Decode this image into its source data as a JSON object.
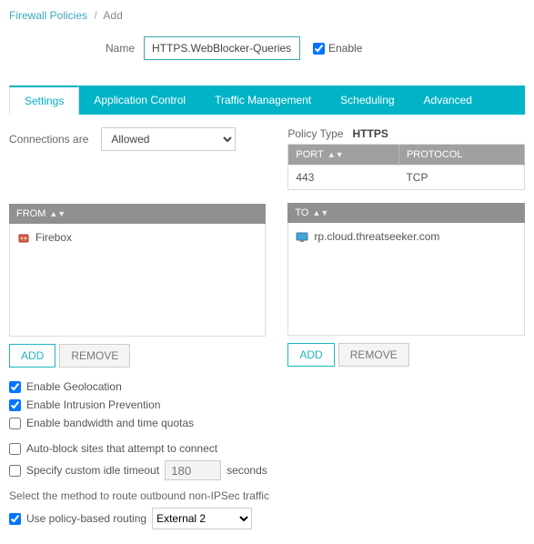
{
  "breadcrumb": {
    "parent": "Firewall Policies",
    "current": "Add"
  },
  "name": {
    "label": "Name",
    "value": "HTTPS.WebBlocker-Queries"
  },
  "enable": {
    "label": "Enable",
    "checked": true
  },
  "tabs": {
    "settings": "Settings",
    "app_control": "Application Control",
    "traffic_mgmt": "Traffic Management",
    "scheduling": "Scheduling",
    "advanced": "Advanced"
  },
  "connections": {
    "label": "Connections are",
    "selected": "Allowed"
  },
  "policy_type": {
    "label": "Policy Type",
    "value": "HTTPS"
  },
  "ports_table": {
    "headers": {
      "port": "PORT",
      "protocol": "PROTOCOL"
    },
    "rows": [
      {
        "port": "443",
        "protocol": "TCP"
      }
    ]
  },
  "from": {
    "header": "FROM",
    "items": [
      {
        "icon": "firebox",
        "label": "Firebox"
      }
    ]
  },
  "to": {
    "header": "TO",
    "items": [
      {
        "icon": "host",
        "label": "rp.cloud.threatseeker.com"
      }
    ]
  },
  "buttons": {
    "add": "ADD",
    "remove": "REMOVE"
  },
  "options": {
    "geo": {
      "label": "Enable Geolocation",
      "checked": true
    },
    "ips": {
      "label": "Enable Intrusion Prevention",
      "checked": true
    },
    "quota": {
      "label": "Enable bandwidth and time quotas",
      "checked": false
    },
    "autoblock": {
      "label": "Auto-block sites that attempt to connect",
      "checked": false
    },
    "idle": {
      "label": "Specify custom idle timeout",
      "checked": false,
      "value": "180",
      "suffix": "seconds"
    }
  },
  "routing": {
    "heading": "Select the method to route outbound non-IPSec traffic",
    "policy_based": {
      "label": "Use policy-based routing",
      "checked": true,
      "selected": "External 2"
    }
  }
}
